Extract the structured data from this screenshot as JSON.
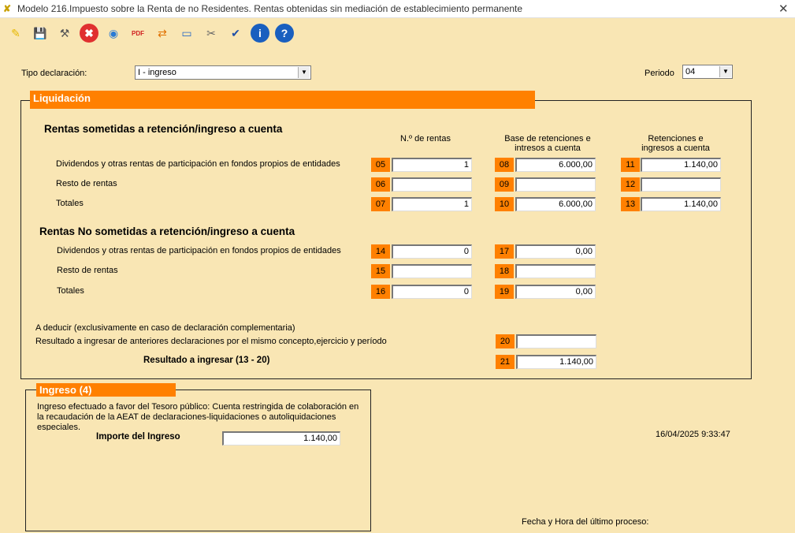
{
  "window": {
    "title": "Modelo 216.Impuesto sobre la Renta de no Residentes.  Rentas obtenidas sin mediación de establecimiento permanente"
  },
  "toolbar": {
    "buttons": [
      {
        "name": "new-icon",
        "glyph": "✎"
      },
      {
        "name": "save-icon",
        "glyph": "💾"
      },
      {
        "name": "wand-icon",
        "glyph": "⚒"
      },
      {
        "name": "cancel-icon",
        "glyph": "✖"
      },
      {
        "name": "web-icon",
        "glyph": "◉"
      },
      {
        "name": "pdf-icon",
        "glyph": "PDF"
      },
      {
        "name": "exchange-icon",
        "glyph": "⇄"
      },
      {
        "name": "monitor-icon",
        "glyph": "▭"
      },
      {
        "name": "tools-icon",
        "glyph": "✂"
      },
      {
        "name": "check-icon",
        "glyph": "✔"
      },
      {
        "name": "info-icon",
        "glyph": "i"
      },
      {
        "name": "help-icon",
        "glyph": "?"
      }
    ]
  },
  "header": {
    "tipo_label": "Tipo declaración:",
    "tipo_value": "I - ingreso",
    "periodo_label": "Periodo",
    "periodo_value": "04"
  },
  "liquidacion": {
    "title": "Liquidación",
    "sometidas_title": "Rentas sometidas a retención/ingreso a cuenta",
    "col_n_rentas": "N.º de rentas",
    "col_base": "Base de retenciones e intresos a cuenta",
    "col_retenciones": "Retenciones e ingresos a cuenta",
    "rows_sometidas": [
      {
        "label": "Dividendos y otras rentas de participación en fondos propios de entidades",
        "c1": "05",
        "v1": "1",
        "c2": "08",
        "v2": "6.000,00",
        "c3": "11",
        "v3": "1.140,00"
      },
      {
        "label": "Resto de rentas",
        "c1": "06",
        "v1": "",
        "c2": "09",
        "v2": "",
        "c3": "12",
        "v3": ""
      },
      {
        "label": "Totales",
        "c1": "07",
        "v1": "1",
        "c2": "10",
        "v2": "6.000,00",
        "c3": "13",
        "v3": "1.140,00"
      }
    ],
    "no_sometidas_title": "Rentas No sometidas a retención/ingreso a cuenta",
    "rows_no_sometidas": [
      {
        "label": "Dividendos y otras rentas de participación en fondos propios de entidades",
        "c1": "14",
        "v1": "0",
        "c2": "17",
        "v2": "0,00"
      },
      {
        "label": "Resto de rentas",
        "c1": "15",
        "v1": "",
        "c2": "18",
        "v2": ""
      },
      {
        "label": "Totales",
        "c1": "16",
        "v1": "0",
        "c2": "19",
        "v2": "0,00"
      }
    ],
    "deducir_label": "A deducir (exclusivamente en caso de declaración complementaria)",
    "anteriores_label": "Resultado a ingresar de anteriores declaraciones por el mismo concepto,ejercicio y período",
    "c20": "20",
    "v20": "",
    "resultado_label": "Resultado a ingresar (13 - 20)",
    "c21": "21",
    "v21": "1.140,00"
  },
  "ingreso": {
    "title": "Ingreso (4)",
    "description": "Ingreso efectuado a favor del Tesoro público: Cuenta restringida de colaboración en la recaudación de la AEAT de declaraciones-liquidaciones o autoliquidaciones especiales.",
    "importe_label": "Importe del Ingreso",
    "importe_value": "1.140,00"
  },
  "footer": {
    "timestamp": "16/04/2025 9:33:47",
    "fecha_label": "Fecha y Hora del último proceso:"
  },
  "colors": {
    "background": "#f9e6b4",
    "accent": "#ff8000"
  }
}
